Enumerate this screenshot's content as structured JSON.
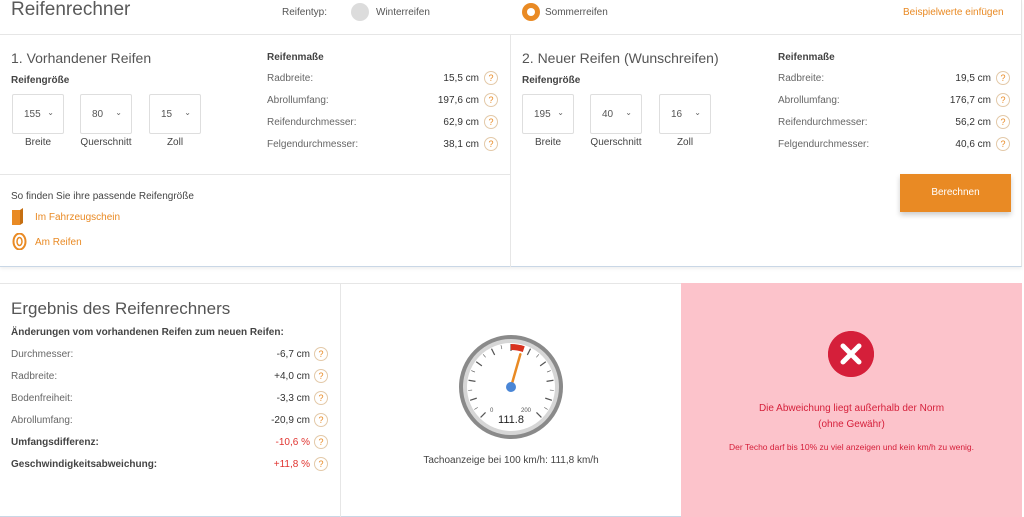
{
  "header": {
    "title": "Reifenrechner",
    "tyre_type_label": "Reifentyp:",
    "tyre_types": [
      {
        "label": "Winterreifen",
        "selected": false
      },
      {
        "label": "Sommerreifen",
        "selected": true
      }
    ],
    "example_link": "Beispielwerte einfügen"
  },
  "existing": {
    "title": "1. Vorhandener Reifen",
    "size_label": "Reifengröße",
    "selects": [
      {
        "value": "155",
        "caption": "Breite"
      },
      {
        "value": "80",
        "caption": "Querschnitt"
      },
      {
        "value": "15",
        "caption": "Zoll"
      }
    ],
    "measures_title": "Reifenmaße",
    "measures": [
      {
        "label": "Radbreite:",
        "value": "15,5 cm"
      },
      {
        "label": "Abrollumfang:",
        "value": "197,6 cm"
      },
      {
        "label": "Reifendurchmesser:",
        "value": "62,9 cm"
      },
      {
        "label": "Felgendurchmesser:",
        "value": "38,1 cm"
      }
    ]
  },
  "new": {
    "title": "2. Neuer Reifen (Wunschreifen)",
    "size_label": "Reifengröße",
    "selects": [
      {
        "value": "195",
        "caption": "Breite"
      },
      {
        "value": "40",
        "caption": "Querschnitt"
      },
      {
        "value": "16",
        "caption": "Zoll"
      }
    ],
    "measures_title": "Reifenmaße",
    "measures": [
      {
        "label": "Radbreite:",
        "value": "19,5 cm"
      },
      {
        "label": "Abrollumfang:",
        "value": "176,7 cm"
      },
      {
        "label": "Reifendurchmesser:",
        "value": "56,2 cm"
      },
      {
        "label": "Felgendurchmesser:",
        "value": "40,6 cm"
      }
    ]
  },
  "help_mark": "?",
  "find": {
    "title": "So finden Sie ihre passende Reifengröße",
    "links": [
      "Im Fahrzeugschein",
      "Am Reifen"
    ]
  },
  "calculate_button": "Berechnen",
  "result": {
    "title": "Ergebnis des Reifenrechners",
    "subtitle": "Änderungen vom vorhandenen Reifen zum neuen Reifen:",
    "rows": [
      {
        "label": "Durchmesser:",
        "value": "-6,7 cm",
        "bold": false,
        "red": false
      },
      {
        "label": "Radbreite:",
        "value": "+4,0 cm",
        "bold": false,
        "red": false
      },
      {
        "label": "Bodenfreiheit:",
        "value": "-3,3 cm",
        "bold": false,
        "red": false
      },
      {
        "label": "Abrollumfang:",
        "value": "-20,9 cm",
        "bold": false,
        "red": false
      },
      {
        "label": "Umfangsdifferenz:",
        "value": "-10,6 %",
        "bold": true,
        "red": true
      },
      {
        "label": "Geschwindigkeitsabweichung:",
        "value": "+11,8 %",
        "bold": true,
        "red": true
      }
    ],
    "gauge": {
      "reading": "111.8",
      "min_label": "0",
      "max_label": "200",
      "value": 111.8,
      "max": 200
    },
    "tacho_caption": "Tachoanzeige bei 100 km/h: 111,8 km/h",
    "error": {
      "line1": "Die Abweichung liegt außerhalb der Norm",
      "line2": "(ohne Gewähr)",
      "note": "Der Techo darf bis 10% zu viel anzeigen und kein km/h zu wenig."
    }
  },
  "colors": {
    "accent": "#e98a24",
    "error_bg": "#fcc3cb",
    "error_text": "#d51f3a"
  }
}
